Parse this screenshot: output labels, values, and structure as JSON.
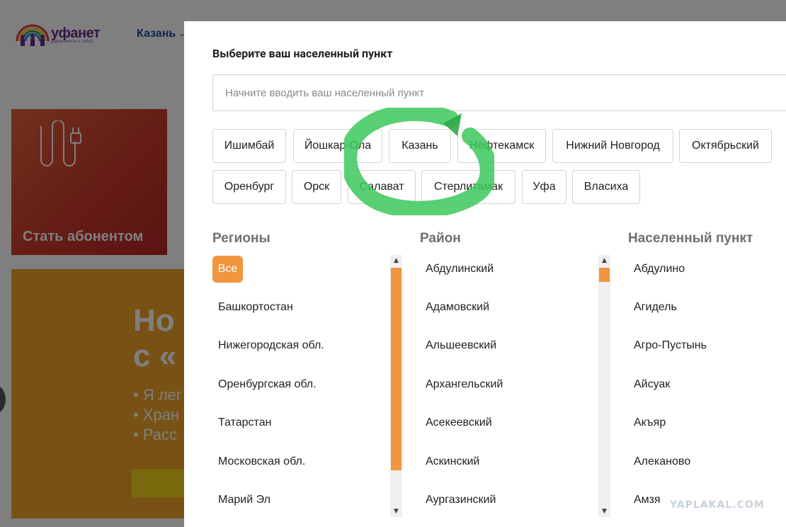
{
  "site": {
    "logo_text": "уфанет",
    "logo_tagline": "дарим мечты с тобой",
    "header_city": "Казань",
    "promo_red_title": "Стать абонентом",
    "promo_heading": "Но\nс «",
    "promo_bullets": "• Я лег\n• Хран\n• Расс"
  },
  "modal": {
    "title": "Выберите ваш населенный пункт",
    "search_placeholder": "Начните вводить ваш населенный пункт",
    "cities": [
      "Ишимбай",
      "Йошкар-Ола",
      "Казань",
      "Нефтекамск",
      "Нижний Новгород",
      "Октябрьский",
      "Оренбург",
      "Орск",
      "Салават",
      "Стерлитамак",
      "Уфа",
      "Власиха"
    ],
    "columns": {
      "regions": {
        "title": "Регионы",
        "all_label": "Все",
        "items": [
          "Башкортостан",
          "Нижегородская обл.",
          "Оренбургская обл.",
          "Татарстан",
          "Московская обл.",
          "Марий Эл"
        ]
      },
      "districts": {
        "title": "Район",
        "items": [
          "Абдулинский",
          "Адамовский",
          "Альшеевский",
          "Архангельский",
          "Асекеевский",
          "Аскинский",
          "Аургазинский"
        ]
      },
      "localities": {
        "title": "Населенный пункт",
        "items": [
          "Абдулино",
          "Агидель",
          "Агро-Пустынь",
          "Айсуак",
          "Акъяр",
          "Алеканово",
          "Амзя"
        ]
      }
    }
  },
  "watermark": "YAPLAKAL.COM",
  "colors": {
    "accent": "#f0963f",
    "annotation": "#3cc85a"
  }
}
